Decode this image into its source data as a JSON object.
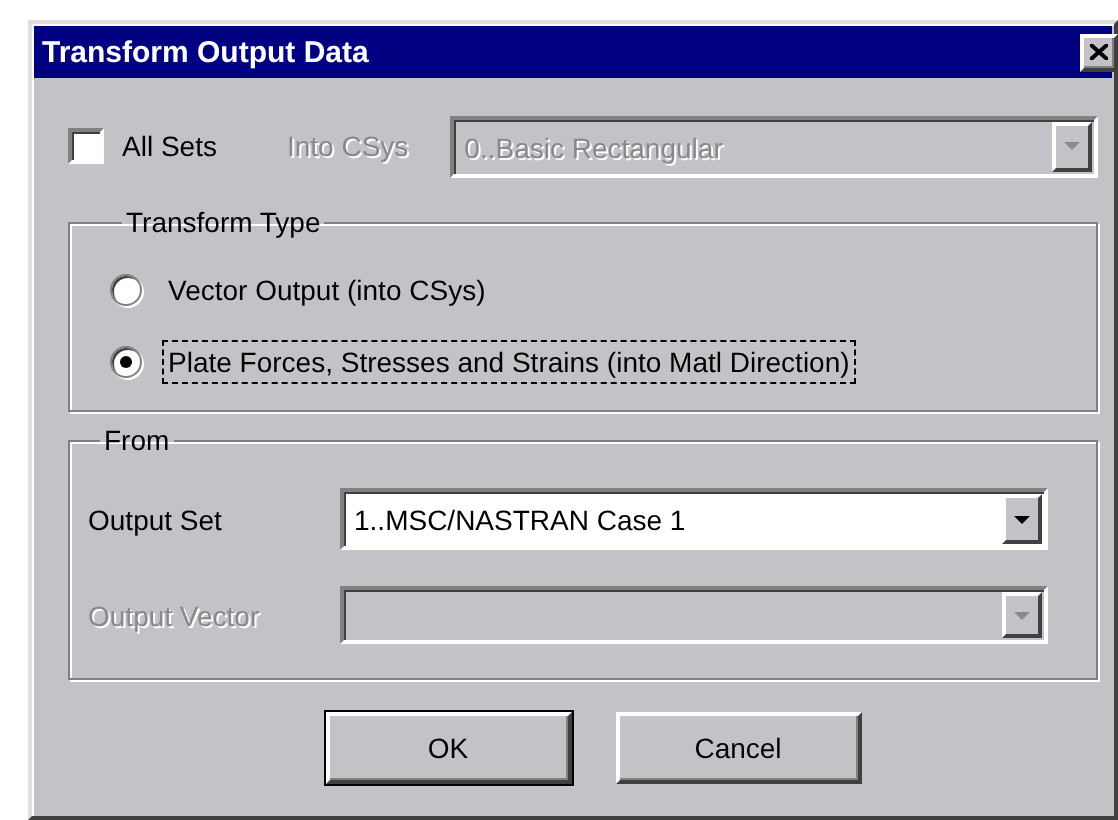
{
  "window": {
    "title": "Transform Output Data"
  },
  "all_sets": {
    "label": "All Sets",
    "checked": false
  },
  "into_csys": {
    "label": "Into CSys",
    "value": "0..Basic Rectangular",
    "disabled": true
  },
  "transform_type": {
    "title": "Transform Type",
    "options": [
      {
        "label": "Vector Output (into CSys)",
        "selected": false,
        "focused": false
      },
      {
        "label": "Plate Forces, Stresses and Strains (into Matl Direction)",
        "selected": true,
        "focused": true
      }
    ]
  },
  "from": {
    "title": "From",
    "fields": [
      {
        "label": "Output Set",
        "value": "1..MSC/NASTRAN Case 1",
        "disabled": false
      },
      {
        "label": "Output Vector",
        "disabled": true
      }
    ]
  },
  "buttons": [
    {
      "label": "OK",
      "default": true
    },
    {
      "label": "Cancel",
      "default": false
    }
  ]
}
